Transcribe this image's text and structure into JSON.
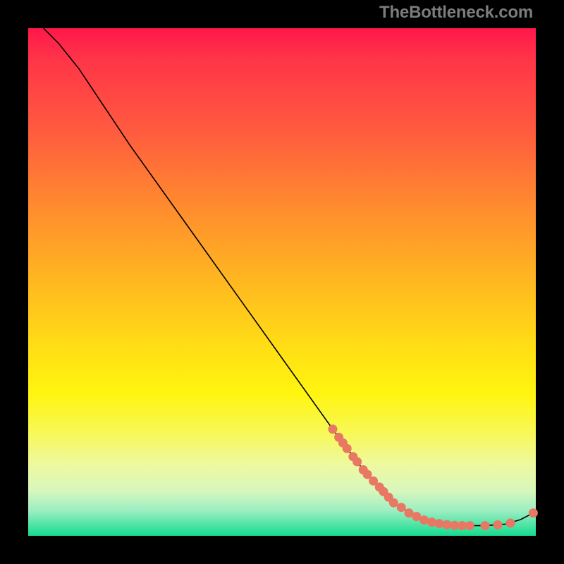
{
  "watermark": "TheBottleneck.com",
  "chart_data": {
    "type": "line",
    "title": "",
    "xlabel": "",
    "ylabel": "",
    "xlim": [
      0,
      100
    ],
    "ylim": [
      0,
      100
    ],
    "grid": false,
    "legend": false,
    "colors": {
      "curve": "#000000",
      "markers": "#e87763"
    },
    "curve": [
      {
        "x": 3,
        "y": 100
      },
      {
        "x": 6,
        "y": 97
      },
      {
        "x": 10,
        "y": 92
      },
      {
        "x": 14,
        "y": 86
      },
      {
        "x": 20,
        "y": 77
      },
      {
        "x": 30,
        "y": 63
      },
      {
        "x": 40,
        "y": 49
      },
      {
        "x": 50,
        "y": 35
      },
      {
        "x": 60,
        "y": 21
      },
      {
        "x": 66,
        "y": 13
      },
      {
        "x": 72,
        "y": 6.5
      },
      {
        "x": 76,
        "y": 4
      },
      {
        "x": 80,
        "y": 2.5
      },
      {
        "x": 85,
        "y": 2
      },
      {
        "x": 90,
        "y": 2
      },
      {
        "x": 94,
        "y": 2.3
      },
      {
        "x": 97,
        "y": 3.2
      },
      {
        "x": 99.5,
        "y": 4.5
      }
    ],
    "markers": [
      {
        "x": 60.0,
        "y": 21.0
      },
      {
        "x": 61.2,
        "y": 19.4
      },
      {
        "x": 62.0,
        "y": 18.3
      },
      {
        "x": 62.8,
        "y": 17.2
      },
      {
        "x": 64.0,
        "y": 15.6
      },
      {
        "x": 64.8,
        "y": 14.6
      },
      {
        "x": 66.0,
        "y": 13.0
      },
      {
        "x": 66.8,
        "y": 12.1
      },
      {
        "x": 68.0,
        "y": 10.8
      },
      {
        "x": 69.2,
        "y": 9.6
      },
      {
        "x": 70.0,
        "y": 8.7
      },
      {
        "x": 71.0,
        "y": 7.6
      },
      {
        "x": 72.0,
        "y": 6.5
      },
      {
        "x": 73.5,
        "y": 5.6
      },
      {
        "x": 75.0,
        "y": 4.5
      },
      {
        "x": 76.5,
        "y": 3.8
      },
      {
        "x": 78.0,
        "y": 3.1
      },
      {
        "x": 79.5,
        "y": 2.7
      },
      {
        "x": 81.0,
        "y": 2.4
      },
      {
        "x": 82.5,
        "y": 2.2
      },
      {
        "x": 84.0,
        "y": 2.05
      },
      {
        "x": 85.5,
        "y": 2.0
      },
      {
        "x": 87.0,
        "y": 2.0
      },
      {
        "x": 90.0,
        "y": 2.0
      },
      {
        "x": 92.5,
        "y": 2.15
      },
      {
        "x": 95.0,
        "y": 2.5
      },
      {
        "x": 99.5,
        "y": 4.5
      }
    ]
  }
}
